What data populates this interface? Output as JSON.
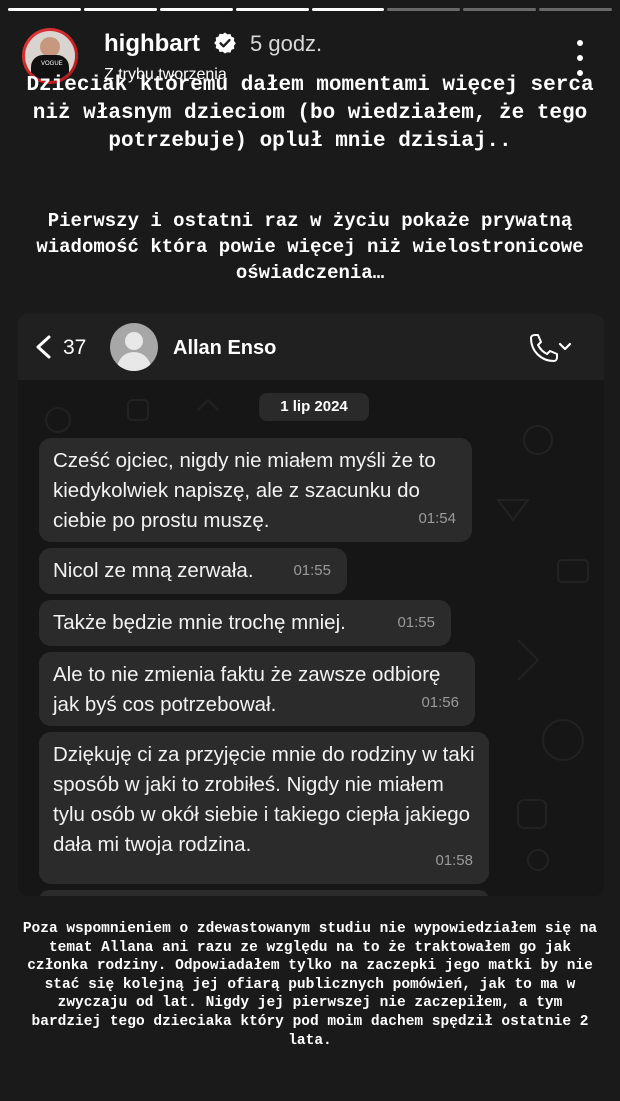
{
  "story": {
    "progress_bars": [
      1,
      1,
      1,
      1,
      1,
      0,
      0,
      0
    ],
    "username": "highbart",
    "time": "5 godz.",
    "subtitle": "Z trybu tworzenia",
    "icons": {
      "verified": "verified-badge-icon",
      "menu": "more-vertical-icon"
    },
    "text_top": "Dzieciak któremu dałem momentami więcej serca niż własnym dzieciom (bo wiedziałem, że tego potrzebuje) opluł mnie dzisiaj..",
    "text_mid": "Pierwszy i ostatni raz w życiu pokaże prywatną wiadomość która powie więcej niż wielostronicowe oświadczenia…",
    "text_bottom": "Poza wspomnieniem o zdewastowanym studiu nie wypowiedziałem się na temat Allana ani razu ze względu na to że traktowałem go jak członka rodziny. Odpowiadałem tylko na zaczepki jego matki by nie stać się  kolejną jej ofiarą publicznych pomówień, jak to ma w zwyczaju od lat. Nigdy jej pierwszej nie zaczepiłem, a tym bardziej tego dzieciaka który pod moim dachem spędził ostatnie 2 lata."
  },
  "chat": {
    "back_count": "37",
    "contact_name": "Allan Enso",
    "date": "1 lip 2024",
    "icons": {
      "back": "chevron-left-icon",
      "call": "phone-icon",
      "dropdown": "chevron-down-icon"
    },
    "messages": [
      {
        "text": "Cześć ojciec, nigdy nie miałem myśli że to kiedykolwiek napiszę, ale z szacunku do ciebie po prostu muszę.",
        "time": "01:54"
      },
      {
        "text": "Nicol ze mną zerwała.",
        "time": "01:55"
      },
      {
        "text": "Także będzie mnie trochę mniej.",
        "time": "01:55"
      },
      {
        "text": "Ale to nie zmienia faktu że zawsze odbiorę jak byś cos potrzebował.",
        "time": "01:56"
      },
      {
        "text": "Dziękuję ci za przyjęcie mnie do rodziny w taki sposób w jaki to zrobiłeś. Nigdy nie miałem tylu osób w okół siebie i takiego ciepła jakiego dała mi twoja rodzina.",
        "time": "01:58"
      }
    ]
  },
  "colors": {
    "background": "#1a1a1a",
    "bubble": "#2b2b2b",
    "chat_header": "#202020"
  }
}
